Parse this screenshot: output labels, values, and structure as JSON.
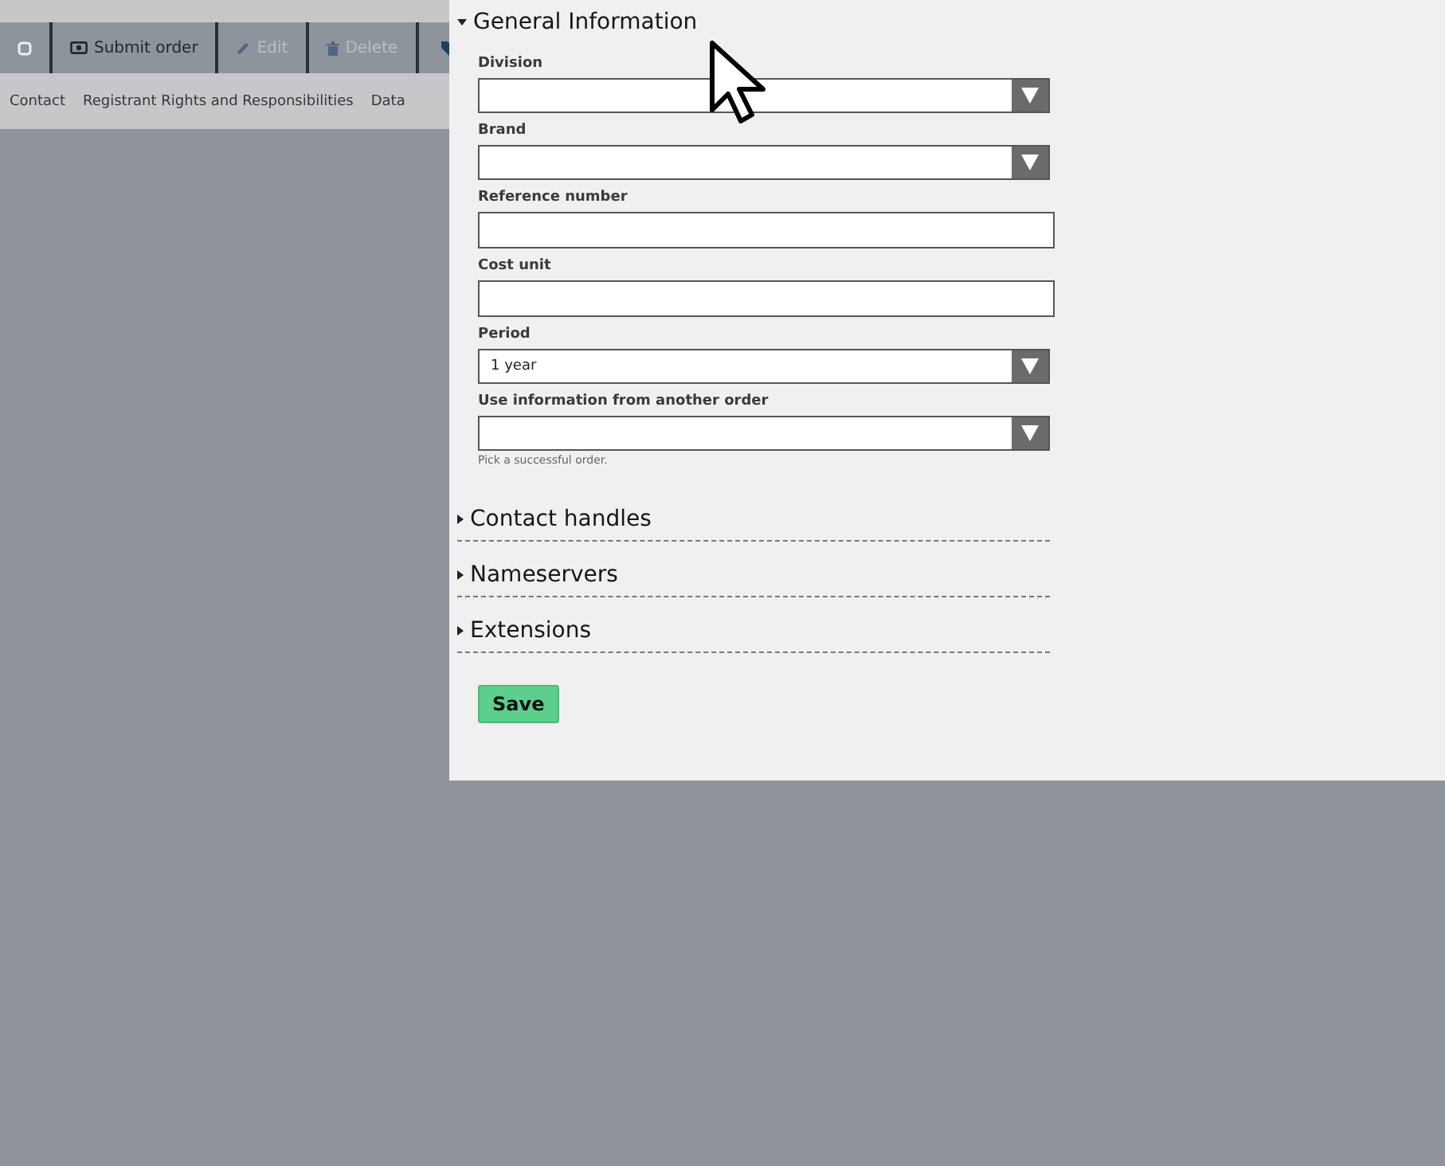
{
  "toolbar": {
    "buttons": [
      {
        "kind": "checkbox",
        "disabled": false
      },
      {
        "kind": "submit",
        "label": "Submit order",
        "disabled": false
      },
      {
        "kind": "edit",
        "label": "Edit",
        "disabled": true
      },
      {
        "kind": "delete",
        "label": "Delete",
        "disabled": true
      },
      {
        "kind": "tag",
        "disabled": false
      }
    ]
  },
  "tabs": [
    {
      "label": "Contact"
    },
    {
      "label": "Registrant Rights and Responsibilities"
    },
    {
      "label": "Data"
    }
  ],
  "form": {
    "sections": [
      {
        "title": "General Information",
        "expanded": true,
        "fields": [
          {
            "kind": "select",
            "label": "Division"
          },
          {
            "kind": "select",
            "label": "Brand"
          },
          {
            "kind": "text",
            "label": "Reference number"
          },
          {
            "kind": "text",
            "label": "Cost unit"
          },
          {
            "kind": "select",
            "label": "Period",
            "value": "1 year"
          },
          {
            "kind": "select",
            "label": "Use information from another order",
            "hint": "Pick a successful order."
          }
        ]
      },
      {
        "title": "Contact handles",
        "expanded": false
      },
      {
        "title": "Nameservers",
        "expanded": false
      },
      {
        "title": "Extensions",
        "expanded": false
      }
    ],
    "save_button": "Save"
  }
}
